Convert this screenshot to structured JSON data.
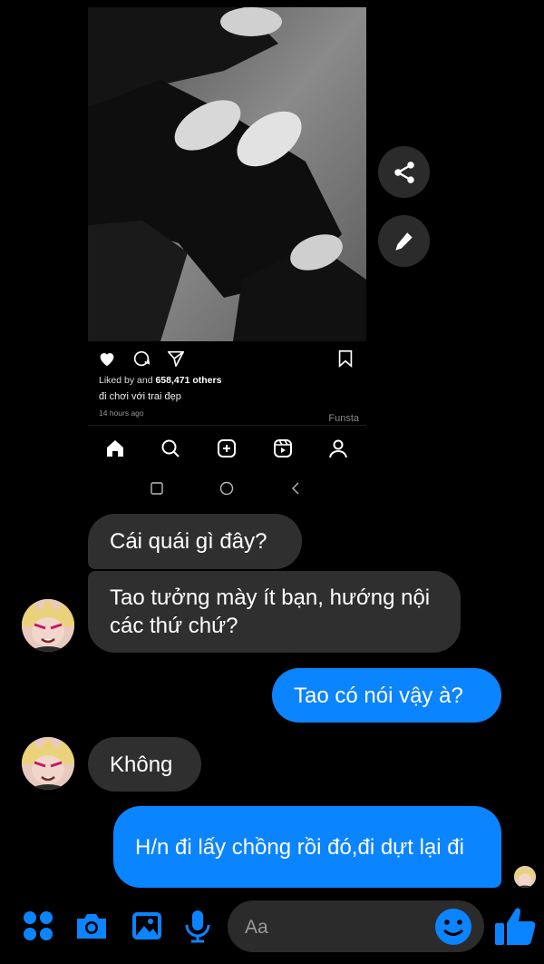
{
  "shared_post": {
    "liked_prefix": "Liked by and",
    "liked_count": "658,471 others",
    "caption": "đi chơi với trai đẹp",
    "time_ago": "14 hours ago",
    "watermark": "Funsta",
    "actions": [
      "heart-icon",
      "comment-icon",
      "send-icon",
      "bookmark-icon"
    ],
    "nav": [
      "home-icon",
      "search-icon",
      "new-post-icon",
      "reels-icon",
      "profile-icon"
    ],
    "system_nav": [
      "recents-icon",
      "home-circle-icon",
      "back-icon"
    ]
  },
  "side_buttons": [
    "share-icon",
    "edit-icon"
  ],
  "messages": [
    {
      "side": "in",
      "text": "Cái quái gì đây?"
    },
    {
      "side": "in",
      "text": "Tao tưởng mày ít bạn, hướng nội các thứ chứ?"
    },
    {
      "side": "out",
      "text": "Tao có nói vậy à?"
    },
    {
      "side": "in",
      "text": "Không"
    },
    {
      "side": "out",
      "text": "H/n đi lấy chồng rồi đó,đi dựt lại đi"
    }
  ],
  "composer": {
    "placeholder": "Aa",
    "icons": [
      "apps-icon",
      "camera-icon",
      "gallery-icon",
      "mic-icon",
      "emoji-icon",
      "like-icon"
    ]
  },
  "colors": {
    "background": "#000000",
    "incoming_bubble": "#2f2f2f",
    "outgoing_bubble": "#0b84ff",
    "accent": "#0b84ff"
  }
}
